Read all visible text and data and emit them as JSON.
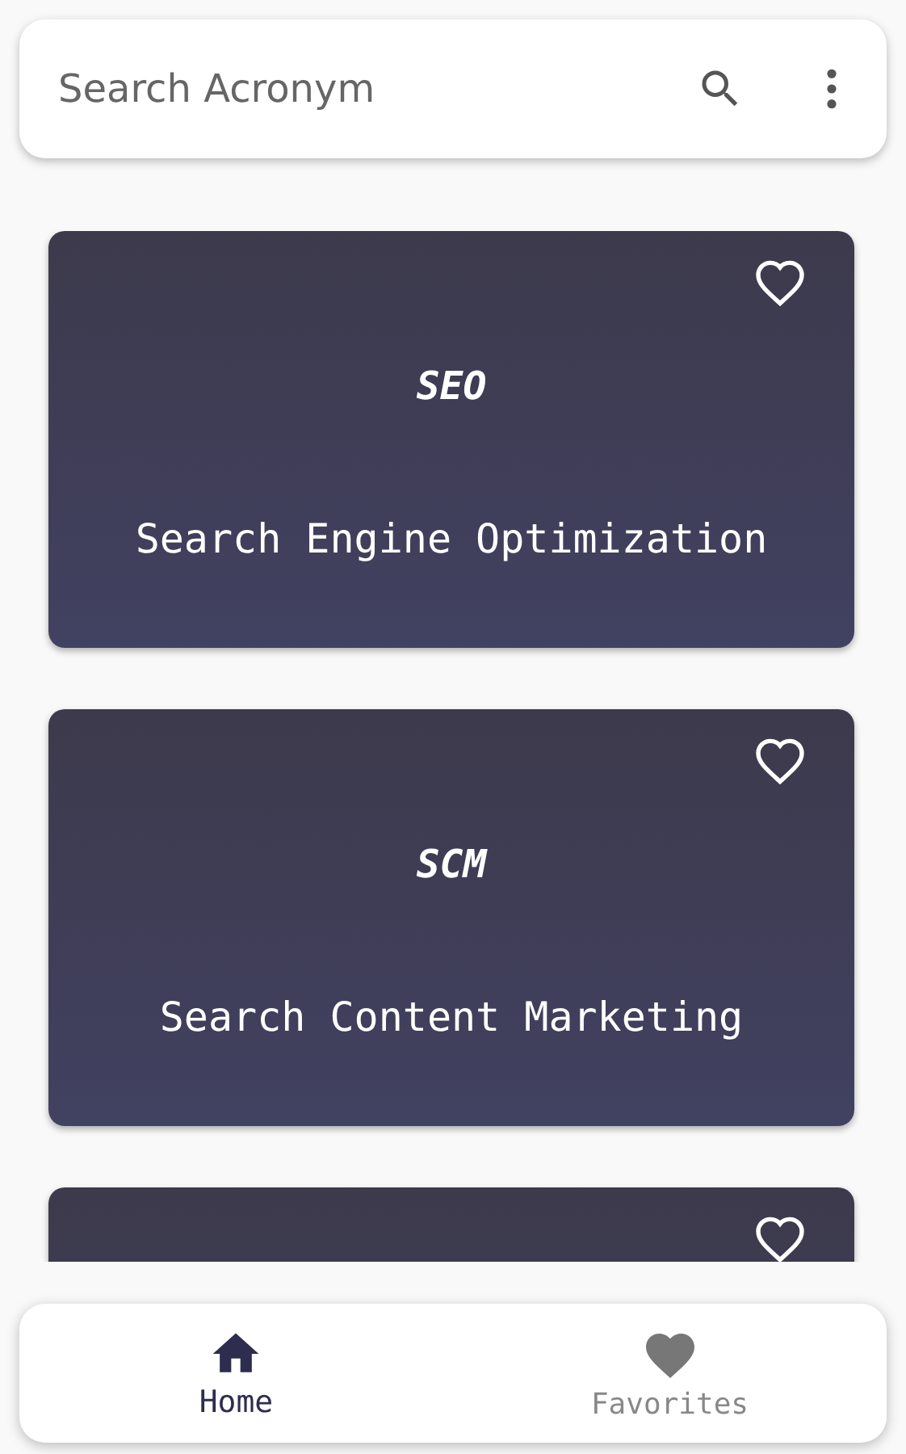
{
  "search": {
    "placeholder": "Search Acronym"
  },
  "cards": [
    {
      "acronym": "SEO",
      "title": "Search Engine Optimization",
      "favorite": false
    },
    {
      "acronym": "SCM",
      "title": "Search Content Marketing",
      "favorite": false
    },
    {
      "favorite": false
    }
  ],
  "nav": [
    {
      "label": "Home",
      "kind": "home",
      "selected": true
    },
    {
      "label": "Favorites",
      "kind": "favorites",
      "selected": false
    }
  ]
}
